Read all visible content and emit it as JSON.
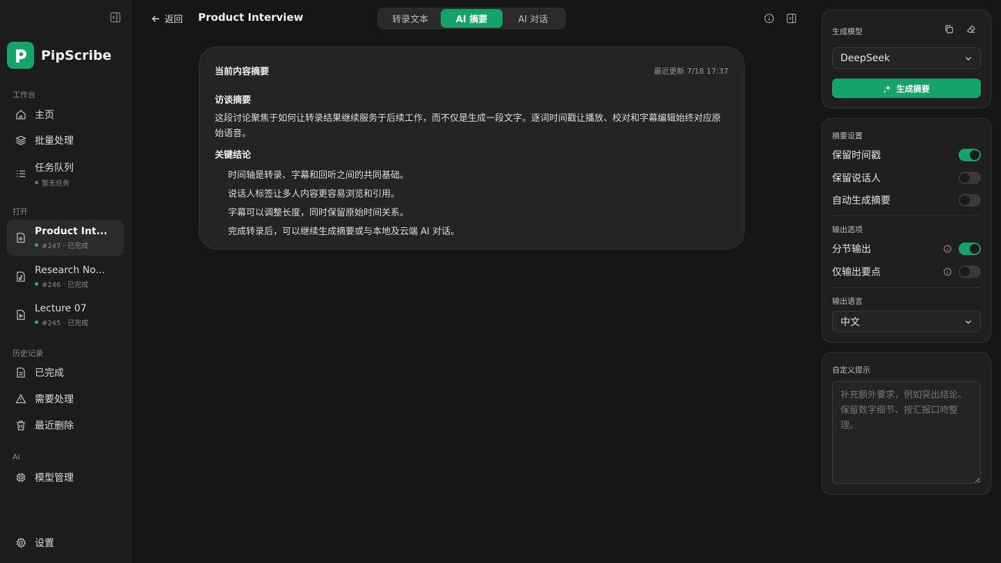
{
  "sidebar": {
    "brand": "PipScribe",
    "sections": {
      "workspace": "工作台",
      "open": "打开",
      "history": "历史记录",
      "ai": "AI"
    },
    "workspace_items": [
      {
        "label": "主页",
        "icon": "home-icon"
      },
      {
        "label": "批量处理",
        "icon": "layers-icon"
      },
      {
        "label": "任务队列",
        "icon": "list-icon",
        "sub": "暂无任务"
      }
    ],
    "open_items": [
      {
        "label": "Product Int...",
        "sub": "#247 · 已完成",
        "icon": "doc-icon"
      },
      {
        "label": "Research No...",
        "sub": "#246 · 已完成",
        "icon": "audio-doc-icon"
      },
      {
        "label": "Lecture 07",
        "sub": "#245 · 已完成",
        "icon": "video-doc-icon"
      }
    ],
    "history_items": [
      {
        "label": "已完成",
        "icon": "doc-icon"
      },
      {
        "label": "需要处理",
        "icon": "warning-icon"
      },
      {
        "label": "最近删除",
        "icon": "trash-icon"
      }
    ],
    "ai_items": [
      {
        "label": "模型管理",
        "icon": "chip-icon"
      }
    ],
    "settings": "设置"
  },
  "topbar": {
    "back": "返回",
    "title": "Product Interview",
    "tabs": [
      "转录文本",
      "AI 摘要",
      "AI 对话"
    ],
    "active_tab": 1
  },
  "summary": {
    "title": "当前内容摘要",
    "updated": "最近更新 7/18 17:37",
    "heading1": "访谈摘要",
    "paragraph": "这段讨论聚焦于如何让转录结果继续服务于后续工作，而不仅是生成一段文字。逐词时间戳让播放、校对和字幕编辑始终对应原始语音。",
    "heading2": "关键结论",
    "bullets": [
      "时间轴是转录、字幕和回听之间的共同基础。",
      "说话人标签让多人内容更容易浏览和引用。",
      "字幕可以调整长度，同时保留原始时间关系。",
      "完成转录后，可以继续生成摘要或与本地及云端 AI 对话。"
    ]
  },
  "model_panel": {
    "label": "生成模型",
    "model": "DeepSeek",
    "generate": "生成摘要"
  },
  "settings_panel": {
    "summary_label": "摘要设置",
    "keep_timestamps": "保留时间戳",
    "keep_speakers": "保留说话人",
    "auto_summary": "自动生成摘要",
    "output_label": "输出选项",
    "section_output": "分节输出",
    "points_only": "仅输出要点",
    "lang_label": "输出语言",
    "language": "中文",
    "toggles": {
      "keep_timestamps": true,
      "keep_speakers": false,
      "auto_summary": false,
      "section_output": true,
      "points_only": false
    }
  },
  "prompt_panel": {
    "label": "自定义提示",
    "placeholder": "补充额外要求，例如突出结论、保留数字细节、按汇报口吻整理。"
  },
  "colors": {
    "accent": "#16a36a",
    "background": "#161616",
    "sidebar": "#1c1c1c"
  }
}
